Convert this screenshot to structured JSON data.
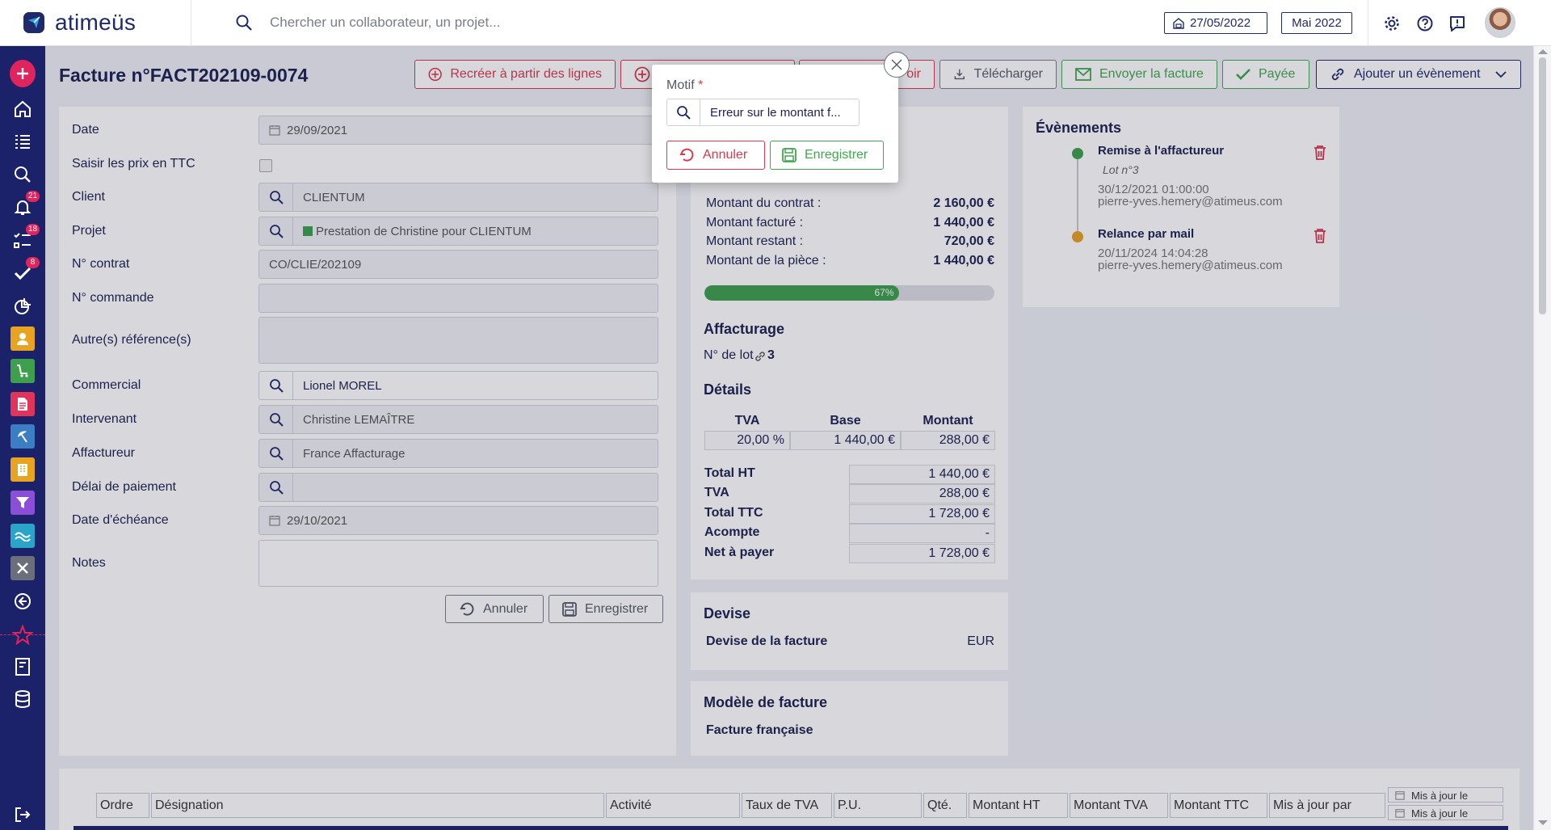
{
  "header": {
    "logo_text": "atimeüs",
    "search_placeholder": "Chercher un collaborateur, un projet...",
    "date": "27/05/2022",
    "month": "Mai 2022",
    "colors": {
      "brand": "#1f2a6b",
      "accent_blue": "#2aa4e8"
    }
  },
  "sidebar": {
    "items": [
      {
        "icon": "add-icon",
        "color": "#e0245e"
      },
      {
        "icon": "home-icon"
      },
      {
        "icon": "list-icon"
      },
      {
        "icon": "search-icon"
      },
      {
        "icon": "bell-icon",
        "badge": "21"
      },
      {
        "icon": "tasks-icon",
        "badge": "18"
      },
      {
        "icon": "check-icon",
        "badge": "8"
      },
      {
        "icon": "chart-icon"
      },
      {
        "icon": "user-icon",
        "color": "#e8a320"
      },
      {
        "icon": "cart-icon",
        "color": "#3ea04c"
      },
      {
        "icon": "document-icon",
        "color": "#e0345a"
      },
      {
        "icon": "beach-icon",
        "color": "#3b7ec4"
      },
      {
        "icon": "building-icon",
        "color": "#e8a320"
      },
      {
        "icon": "filter-icon",
        "color": "#8a4fd6"
      },
      {
        "icon": "wave-icon",
        "color": "#2aa4c8"
      },
      {
        "icon": "tools-icon",
        "color": "#6b6f7b"
      },
      {
        "icon": "back-icon"
      },
      {
        "icon": "star-icon",
        "color": "#e0245e"
      },
      {
        "icon": "invoice-icon"
      },
      {
        "icon": "database-icon"
      },
      {
        "icon": "logout-icon"
      }
    ]
  },
  "page": {
    "title": "Facture n°FACT202109-0074"
  },
  "actions": {
    "recreate": "Recréer à partir des lignes",
    "credit": "oir",
    "download": "Télécharger",
    "send": "Envoyer la facture",
    "paid": "Payée",
    "add_event": "Ajouter un évènement"
  },
  "form": {
    "date_label": "Date",
    "date_value": "29/09/2021",
    "ttc_label": "Saisir les prix en TTC",
    "client_label": "Client",
    "client_value": "CLIENTUM",
    "projet_label": "Projet",
    "projet_value": "Prestation de Christine pour CLIENTUM",
    "contrat_label": "N° contrat",
    "contrat_value": "CO/CLIE/202109",
    "commande_label": "N° commande",
    "commande_value": "",
    "refs_label": "Autre(s) référence(s)",
    "commercial_label": "Commercial",
    "commercial_value": "Lionel MOREL",
    "intervenant_label": "Intervenant",
    "intervenant_value": "Christine LEMAÎTRE",
    "affactureur_label": "Affactureur",
    "affactureur_value": "France Affacturage",
    "delai_label": "Délai de paiement",
    "delai_value": "",
    "echeance_label": "Date d'échéance",
    "echeance_value": "29/10/2021",
    "notes_label": "Notes",
    "cancel": "Annuler",
    "save": "Enregistrer"
  },
  "amounts": {
    "contrat_label": "Montant du contrat :",
    "contrat_value": "2 160,00 €",
    "facture_label": "Montant facturé :",
    "facture_value": "1 440,00 €",
    "restant_label": "Montant restant :",
    "restant_value": "720,00 €",
    "piece_label": "Montant de la pièce :",
    "piece_value": "1 440,00 €",
    "progress_percent": 67,
    "progress_label": "67%"
  },
  "affacturage": {
    "title": "Affacturage",
    "lot_label": "N° de lot",
    "lot_value": "3"
  },
  "details": {
    "title": "Détails",
    "headers": [
      "TVA",
      "Base",
      "Montant"
    ],
    "row": [
      "20,00 %",
      "1 440,00 €",
      "288,00 €"
    ],
    "totals": [
      {
        "label": "Total HT",
        "value": "1 440,00 €"
      },
      {
        "label": "TVA",
        "value": "288,00 €"
      },
      {
        "label": "Total TTC",
        "value": "1 728,00 €"
      },
      {
        "label": "Acompte",
        "value": "-"
      },
      {
        "label": "Net à payer",
        "value": "1 728,00 €"
      }
    ]
  },
  "devise": {
    "title": "Devise",
    "label": "Devise de la facture",
    "value": "EUR"
  },
  "modele": {
    "title": "Modèle de facture",
    "value": "Facture française"
  },
  "events": {
    "title": "Évènements",
    "items": [
      {
        "title": "Remise à l'affactureur",
        "sub": "Lot n°3",
        "date": "30/12/2021 01:00:00",
        "user": "pierre-yves.hemery@atimeus.com",
        "color": "#3ea04c"
      },
      {
        "title": "Relance par mail",
        "sub": "",
        "date": "20/11/2024 14:04:28",
        "user": "pierre-yves.hemery@atimeus.com",
        "color": "#e8a320"
      }
    ]
  },
  "lines_table": {
    "columns": [
      "Ordre",
      "Désignation",
      "Activité",
      "Taux de TVA",
      "P.U.",
      "Qté.",
      "Montant HT",
      "Montant TVA",
      "Montant TTC",
      "Mis à jour par",
      "Mis à jour le"
    ]
  },
  "modal": {
    "label": "Motif",
    "required_mark": "*",
    "value": "Erreur sur le montant f...",
    "cancel": "Annuler",
    "save": "Enregistrer"
  }
}
